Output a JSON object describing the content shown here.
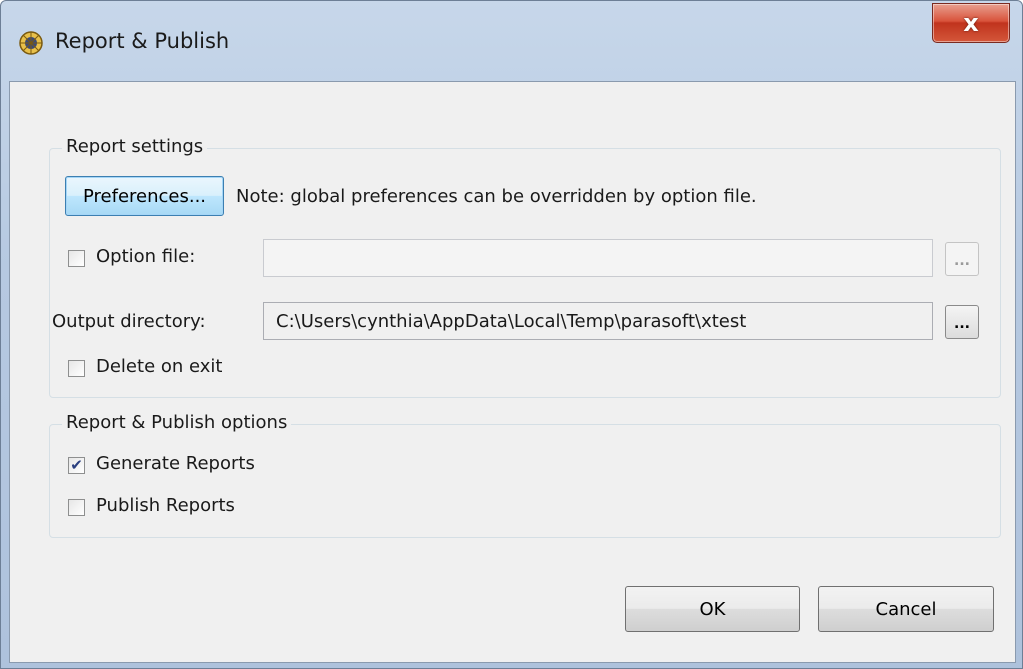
{
  "window": {
    "title": "Report & Publish",
    "icon": "parasoft-app-icon",
    "close_label": "x"
  },
  "report_settings": {
    "group_title": "Report settings",
    "preferences_button": "Preferences...",
    "note": "Note: global preferences can be overridden by option file.",
    "option_file": {
      "label": "Option file:",
      "checked": false,
      "value": "",
      "browse_label": "..."
    },
    "output_directory": {
      "label": "Output directory:",
      "value": "C:\\Users\\cynthia\\AppData\\Local\\Temp\\parasoft\\xtest",
      "browse_label": "..."
    },
    "delete_on_exit": {
      "label": "Delete on exit",
      "checked": false
    }
  },
  "publish_options": {
    "group_title": "Report & Publish options",
    "generate_reports": {
      "label": "Generate Reports",
      "checked": true
    },
    "publish_reports": {
      "label": "Publish Reports",
      "checked": false
    }
  },
  "footer": {
    "ok_label": "OK",
    "cancel_label": "Cancel"
  },
  "colors": {
    "accent": "#3c7fb1",
    "close_red": "#c0331d",
    "dialog_bg": "#f0f0f0"
  }
}
